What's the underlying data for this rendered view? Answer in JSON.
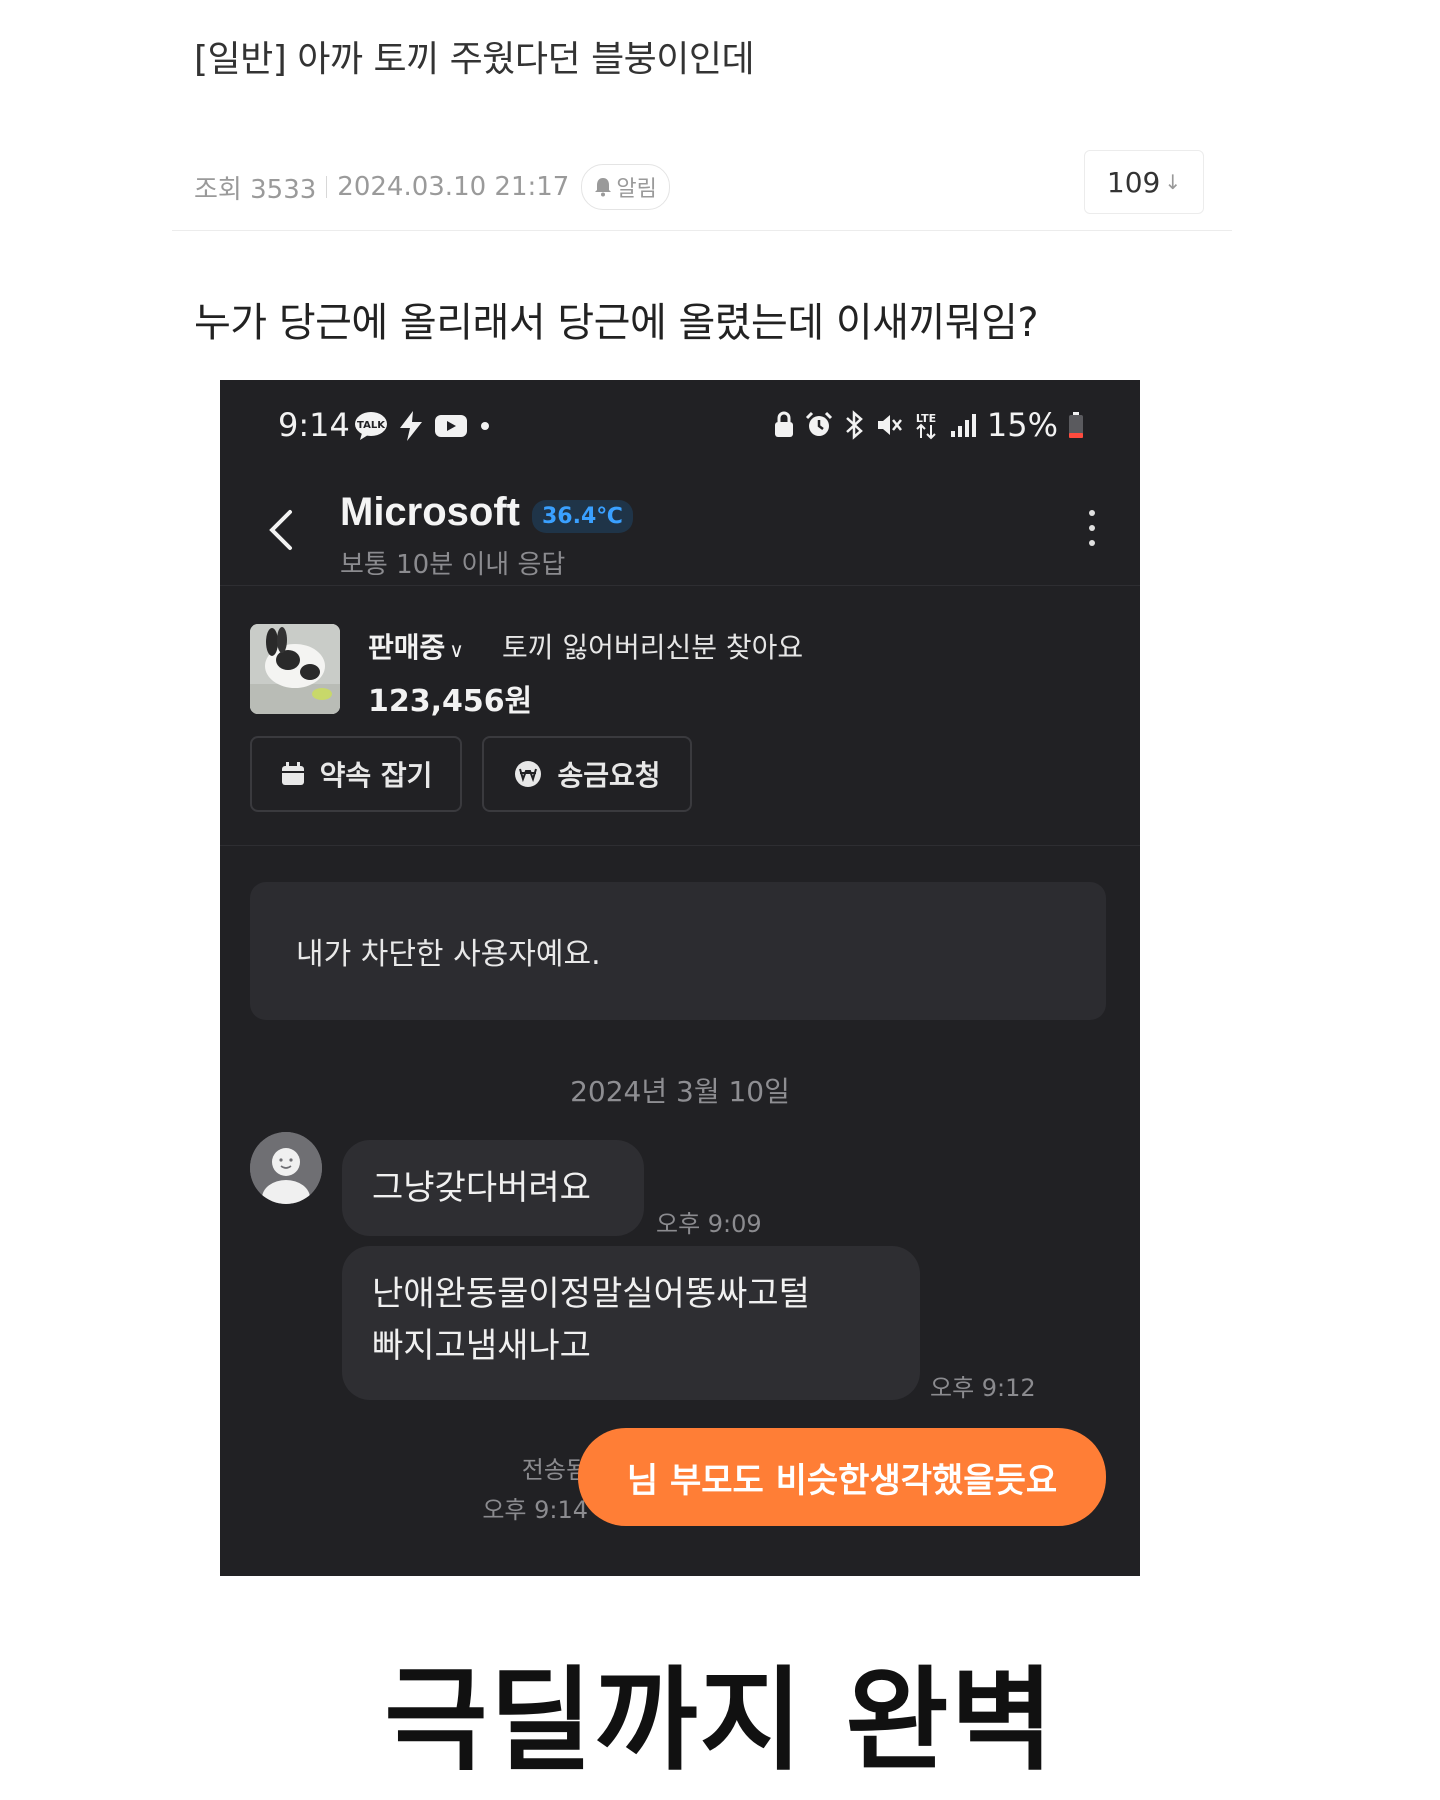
{
  "post": {
    "title": "[일반] 아까 토끼 주웠다던 블붕이인데",
    "meta_views": "조회 3533",
    "meta_datetime": "2024.03.10 21:17",
    "alarm_label": "알림",
    "count": "109",
    "body_text": "누가 당근에 올리래서 당근에 올렸는데 이새끼뭐임?"
  },
  "phone": {
    "status_time": "9:14",
    "battery": "15%",
    "chat_name": "Microsoft",
    "manner_temp": "36.4℃",
    "response_note": "보통 10분 이내 응답",
    "product": {
      "status": "판매중",
      "title": "토끼 잃어버리신분 찾아요",
      "price": "123,456원"
    },
    "buttons": {
      "appointment": "약속 잡기",
      "remit": "송금요청"
    },
    "blocked_notice": "내가 차단한 사용자예요.",
    "date_divider": "2024년 3월 10일",
    "messages": [
      {
        "text": "그냥갖다버려요",
        "time": "오후 9:09"
      },
      {
        "text_line1": "난애완동물이정말실어똥싸고털",
        "text_line2": "빠지고냄새나고",
        "time": "오후 9:12"
      }
    ],
    "my_message": {
      "text": "님 부모도 비슷한생각했을듯요",
      "status": "전송됨",
      "time": "오후 9:14"
    }
  },
  "caption": "극딜까지 완벽",
  "colors": {
    "chat_bg": "#212124",
    "bubble_other": "#2e2e32",
    "bubble_mine": "#ff7e36",
    "temp_blue": "#3aa0ff"
  }
}
